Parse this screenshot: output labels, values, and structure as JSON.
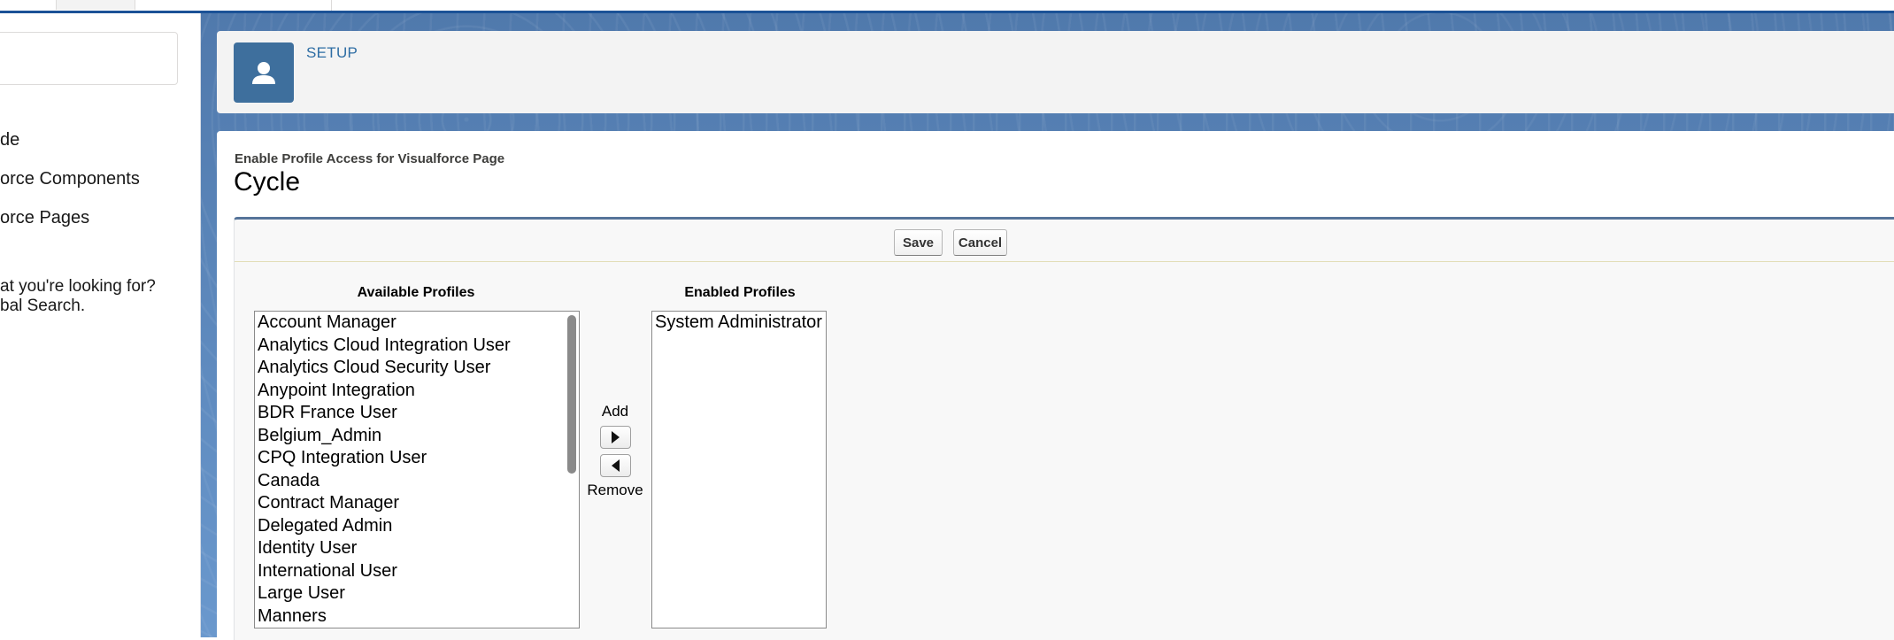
{
  "colors": {
    "brand_blue": "#1b5297",
    "setup_tile": "#3e6f9d",
    "setup_text": "#2e6da4",
    "block_border": "#56749a"
  },
  "sidebar": {
    "search_placeholder": "",
    "nav_items": [
      {
        "label": "de"
      },
      {
        "label": "orce Components"
      },
      {
        "label": "orce Pages"
      }
    ],
    "help_lines": [
      "at you're looking for?",
      "bal Search."
    ]
  },
  "header": {
    "icon": "user-icon",
    "label": "SETUP"
  },
  "page": {
    "type_label": "Enable Profile Access for Visualforce Page",
    "title": "Cycle"
  },
  "toolbar": {
    "save_label": "Save",
    "cancel_label": "Cancel"
  },
  "available": {
    "header": "Available Profiles",
    "options": [
      "Account Manager",
      "Analytics Cloud Integration User",
      "Analytics Cloud Security User",
      "Anypoint Integration",
      "BDR France User",
      "Belgium_Admin",
      "CPQ Integration User",
      "Canada",
      "Contract Manager",
      "Delegated Admin",
      "Identity User",
      "International User",
      "Large User",
      "Manners"
    ]
  },
  "enabled": {
    "header": "Enabled Profiles",
    "options": [
      "System Administrator"
    ]
  },
  "move": {
    "add_label": "Add",
    "remove_label": "Remove",
    "add_icon": "arrow-right-icon",
    "remove_icon": "arrow-left-icon"
  }
}
